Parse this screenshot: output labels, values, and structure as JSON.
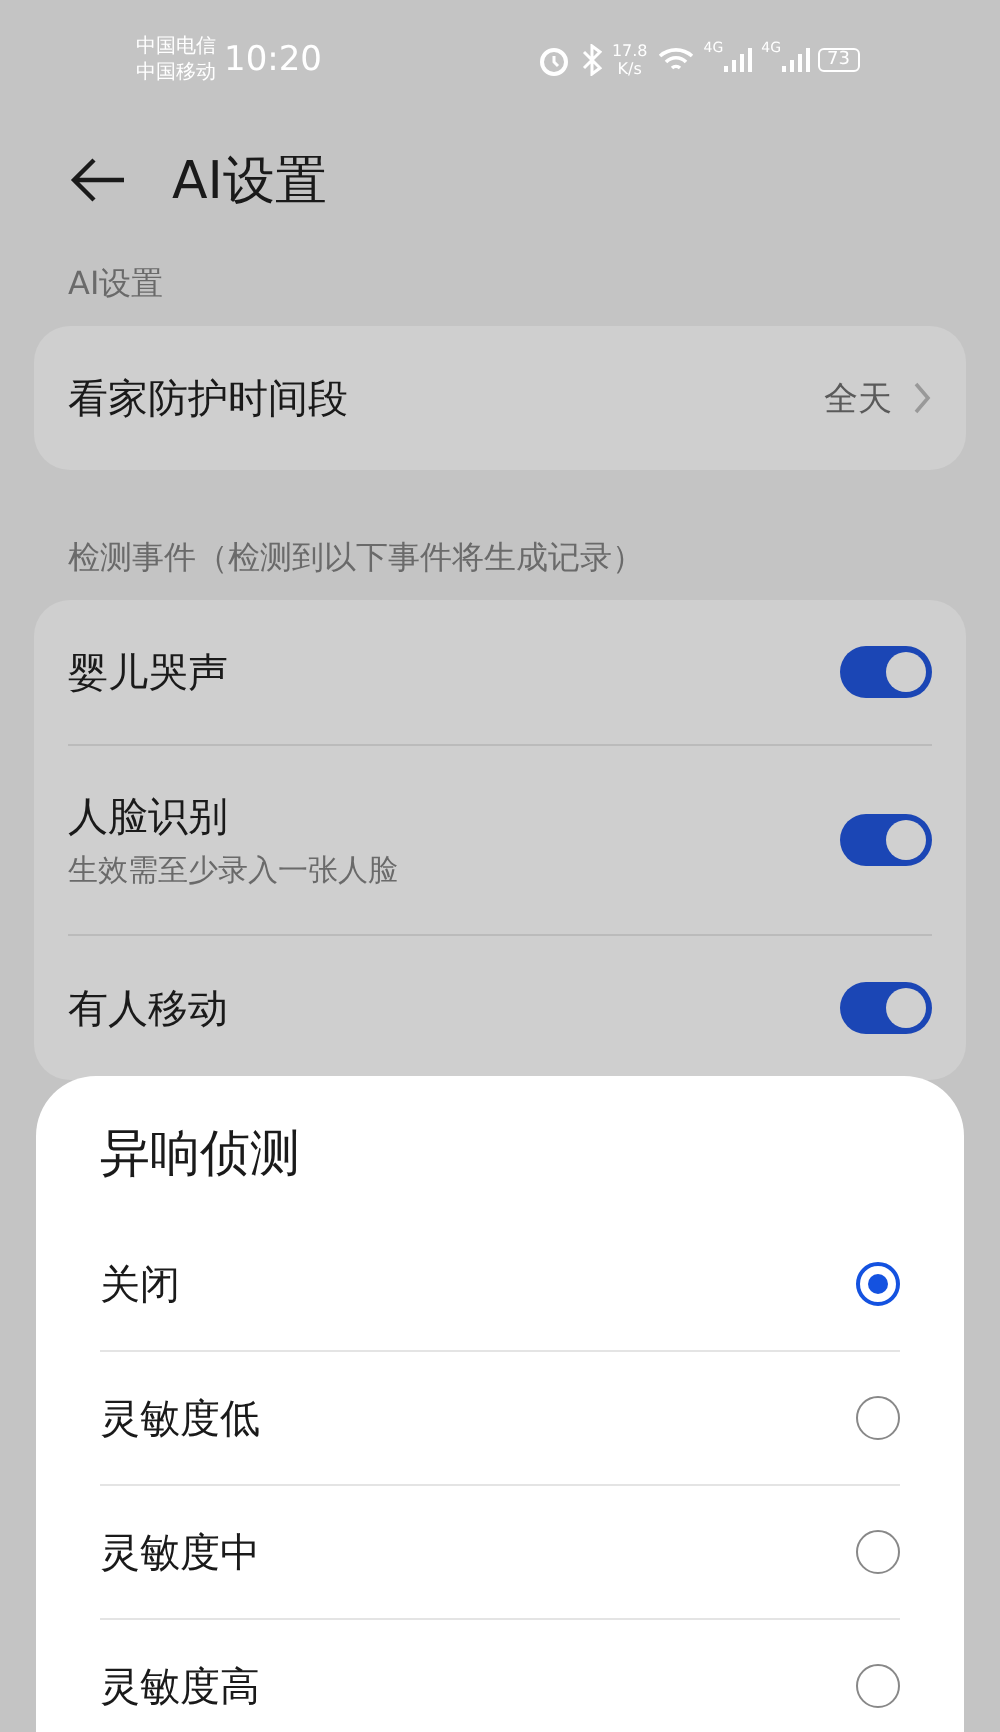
{
  "status_bar": {
    "carrier_1": "中国电信",
    "carrier_2": "中国移动",
    "time": "10:20",
    "speed_value": "17.8",
    "speed_unit": "K/s",
    "network_1": "4G",
    "network_2": "4G",
    "battery": "73"
  },
  "header": {
    "title": "AI设置"
  },
  "sections": [
    {
      "title": "AI设置",
      "rows": [
        {
          "kind": "link",
          "label": "看家防护时间段",
          "value": "全天"
        }
      ]
    },
    {
      "title": "检测事件（检测到以下事件将生成记录）",
      "rows": [
        {
          "kind": "toggle",
          "label": "婴儿哭声",
          "on": true
        },
        {
          "kind": "toggle",
          "label": "人脸识别",
          "subtitle": "生效需至少录入一张人脸",
          "on": true
        },
        {
          "kind": "toggle",
          "label": "有人移动",
          "on": true
        }
      ]
    }
  ],
  "sheet": {
    "title": "异响侦测",
    "options": [
      {
        "label": "关闭",
        "selected": true
      },
      {
        "label": "灵敏度低",
        "selected": false
      },
      {
        "label": "灵敏度中",
        "selected": false
      },
      {
        "label": "灵敏度高",
        "selected": false
      }
    ]
  }
}
